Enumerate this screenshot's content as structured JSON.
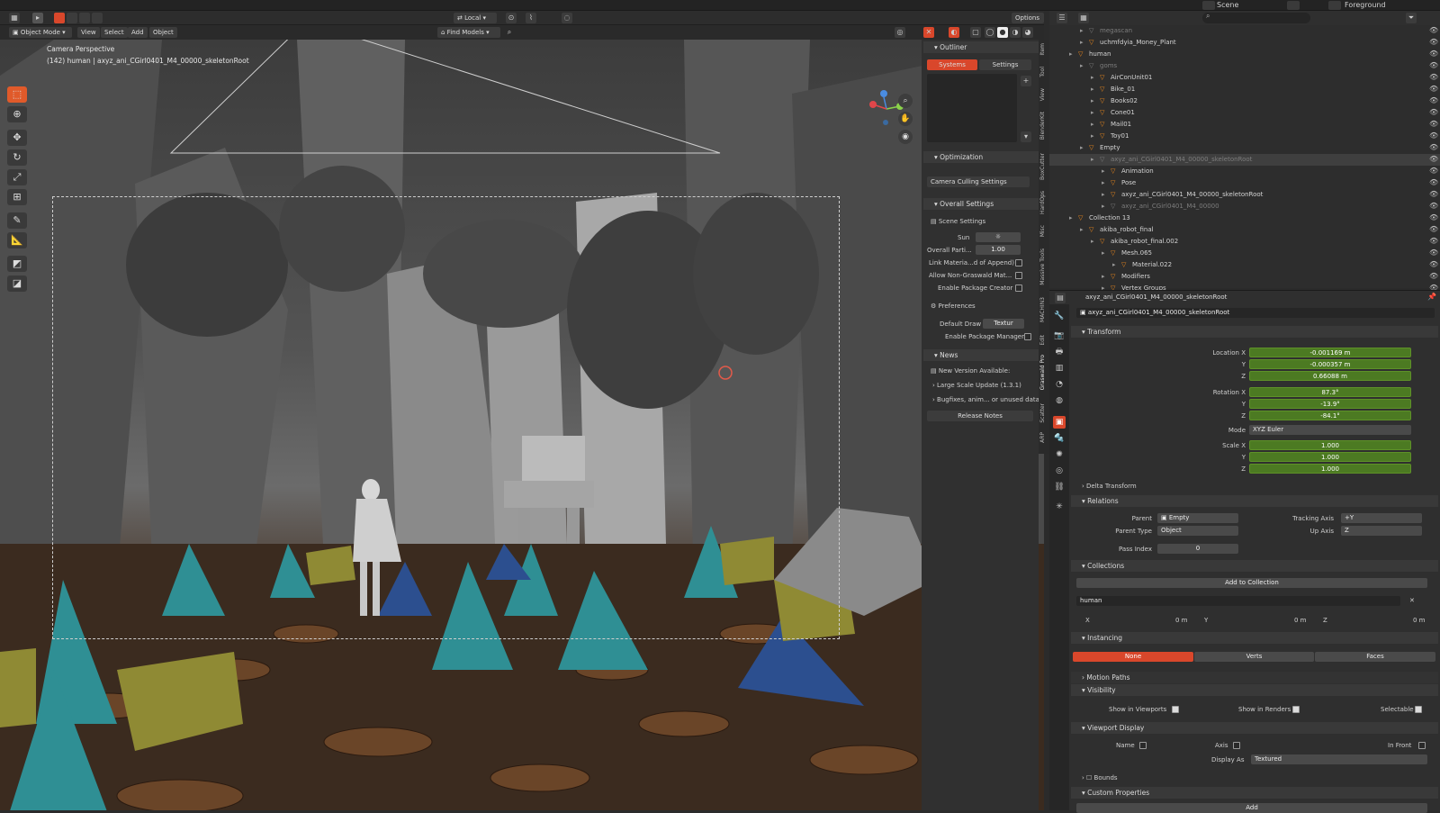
{
  "topbar": {
    "scene": "Scene",
    "foreground": "Foreground"
  },
  "viewport_header": {
    "mode": "Object Mode",
    "menus": [
      "View",
      "Select",
      "Add",
      "Object"
    ],
    "pivot": "Local",
    "find_models": "Find Models",
    "options": "Options"
  },
  "viewport": {
    "camera_label": "Camera Perspective",
    "object_label": "(142) human | axyz_ani_CGirl0401_M4_00000_skeletonRoot"
  },
  "npanel": {
    "outliner_title": "Outliner",
    "tab_systems": "Systems",
    "tab_settings": "Settings",
    "optimization": "Optimization",
    "camera_culling": "Camera Culling Settings",
    "overall_settings": "Overall Settings",
    "scene_settings": "Scene Settings",
    "sun": "Sun",
    "overall_parti": "Overall Parti...",
    "overall_parti_val": "1.00",
    "link_material": "Link Materia...d of Append)",
    "allow_non_graswald": "Allow Non-Graswald Mat...",
    "enable_package_creator": "Enable Package Creator",
    "preferences": "Preferences",
    "default_draw": "Default Draw",
    "default_draw_val": "Textur",
    "enable_package_manager": "Enable Package Manager",
    "news": "News",
    "new_version": "New Version Available:",
    "large_scale": "Large Scale Update (1.3.1)",
    "bugfixes": "Bugfixes, anim... or unused data",
    "release_notes": "Release Notes",
    "vtabs": [
      "Item",
      "Tool",
      "View",
      "BlenderKit",
      "BoxCutter",
      "HardOps",
      "Misc",
      "Massive Tools",
      "MACHIN3",
      "Edit",
      "Graswald Pro",
      "Scatter",
      "ARP"
    ]
  },
  "outliner": {
    "rows": [
      {
        "label": "megascan",
        "depth": 3,
        "dim": true,
        "sel": false
      },
      {
        "label": "uchmfdyia_Money_Plant",
        "depth": 3,
        "dim": false,
        "sel": false
      },
      {
        "label": "human",
        "depth": 2,
        "dim": false,
        "sel": false
      },
      {
        "label": "goms",
        "depth": 3,
        "dim": true,
        "sel": false
      },
      {
        "label": "AirConUnit01",
        "depth": 4,
        "dim": false,
        "sel": false
      },
      {
        "label": "Bike_01",
        "depth": 4,
        "dim": false,
        "sel": false
      },
      {
        "label": "Books02",
        "depth": 4,
        "dim": false,
        "sel": false
      },
      {
        "label": "Cone01",
        "depth": 4,
        "dim": false,
        "sel": false
      },
      {
        "label": "Mail01",
        "depth": 4,
        "dim": false,
        "sel": false
      },
      {
        "label": "Toy01",
        "depth": 4,
        "dim": false,
        "sel": false
      },
      {
        "label": "Empty",
        "depth": 3,
        "dim": false,
        "sel": false
      },
      {
        "label": "axyz_ani_CGirl0401_M4_00000_skeletonRoot",
        "depth": 4,
        "dim": true,
        "sel": true
      },
      {
        "label": "Animation",
        "depth": 5,
        "dim": false,
        "sel": false
      },
      {
        "label": "Pose",
        "depth": 5,
        "dim": false,
        "sel": false
      },
      {
        "label": "axyz_ani_CGirl0401_M4_00000_skeletonRoot",
        "depth": 5,
        "dim": false,
        "sel": false
      },
      {
        "label": "axyz_ani_CGirl0401_M4_00000",
        "depth": 5,
        "dim": true,
        "sel": false
      },
      {
        "label": "Collection 13",
        "depth": 2,
        "dim": false,
        "sel": false
      },
      {
        "label": "akiba_robot_final",
        "depth": 3,
        "dim": false,
        "sel": false
      },
      {
        "label": "akiba_robot_final.002",
        "depth": 4,
        "dim": false,
        "sel": false
      },
      {
        "label": "Mesh.065",
        "depth": 5,
        "dim": false,
        "sel": false
      },
      {
        "label": "Material.022",
        "depth": 6,
        "dim": false,
        "sel": false
      },
      {
        "label": "Modifiers",
        "depth": 5,
        "dim": false,
        "sel": false
      },
      {
        "label": "Vertex Groups",
        "depth": 5,
        "dim": false,
        "sel": false
      }
    ]
  },
  "properties": {
    "header_object": "axyz_ani_CGirl0401_M4_00000_skeletonRoot",
    "name_field": "axyz_ani_CGirl0401_M4_00000_skeletonRoot",
    "transform": "Transform",
    "location_x_label": "Location X",
    "location_x": "-0.001169 m",
    "location_y": "-0.000357 m",
    "location_z": "0.66088 m",
    "rotation_x_label": "Rotation X",
    "rotation_x": "87.3°",
    "rotation_y": "-13.9°",
    "rotation_z": "-84.1°",
    "y_label": "Y",
    "z_label": "Z",
    "mode_label": "Mode",
    "mode_val": "XYZ Euler",
    "scale_x_label": "Scale X",
    "scale_x": "1.000",
    "scale_y": "1.000",
    "scale_z": "1.000",
    "delta_transform": "Delta Transform",
    "relations": "Relations",
    "parent_label": "Parent",
    "parent_val": "Empty",
    "parent_type_label": "Parent Type",
    "parent_type_val": "Object",
    "tracking_axis_label": "Tracking Axis",
    "tracking_axis_val": "+Y",
    "up_axis_label": "Up Axis",
    "up_axis_val": "Z",
    "pass_index_label": "Pass Index",
    "pass_index_val": "0",
    "collections": "Collections",
    "add_to_collection": "Add to Collection",
    "collection_name": "human",
    "cx_label": "X",
    "cx_val": "0 m",
    "cy_label": "Y",
    "cy_val": "0 m",
    "cz_label": "Z",
    "cz_val": "0 m",
    "instancing": "Instancing",
    "inst_none": "None",
    "inst_verts": "Verts",
    "inst_faces": "Faces",
    "motion_paths": "Motion Paths",
    "visibility": "Visibility",
    "show_viewports": "Show in Viewports",
    "show_renders": "Show in Renders",
    "selectable": "Selectable",
    "viewport_display": "Viewport Display",
    "name_lbl": "Name",
    "axis_lbl": "Axis",
    "in_front_lbl": "In Front",
    "display_as_label": "Display As",
    "display_as_val": "Textured",
    "bounds": "Bounds",
    "custom_properties": "Custom Properties",
    "add": "Add"
  },
  "colors": {
    "accent": "#d9472b",
    "field_green": "#4c7a22",
    "selection": "#3f3f3f"
  }
}
